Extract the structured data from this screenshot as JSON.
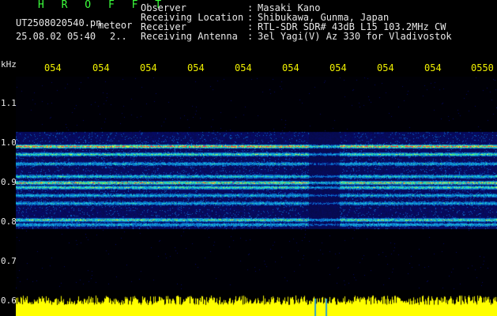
{
  "header": {
    "title": "H R O F F T",
    "file": "UT2508020540.pn",
    "meteor_label": "meteor",
    "datetime": "25.08.02 05:40",
    "count": "2.."
  },
  "info": [
    {
      "label": "Observer",
      "value": "Masaki Kano"
    },
    {
      "label": "Receiving Location",
      "value": "Shibukawa, Gunma, Japan"
    },
    {
      "label": "Receiver",
      "value": "RTL-SDR SDR# 43dB L15 103.2MHz CW"
    },
    {
      "label": "Receiving Antenna",
      "value": "3el Yagi(V) Az 330 for Vladivostok"
    }
  ],
  "axis": {
    "unit": "kHz",
    "y_ticks": [
      "1.1",
      "1.0",
      "0.9",
      "0.8",
      "0.7",
      "0.6"
    ],
    "x_ticks": [
      "054",
      "054",
      "054",
      "054",
      "054",
      "054",
      "054",
      "054",
      "054",
      "0550"
    ]
  },
  "colors": {
    "background": "#000000",
    "title": "#3cff3c",
    "tick_x": "#f0f000",
    "spectrum_base": "#06062e",
    "power_fill": "#ffff00"
  }
}
